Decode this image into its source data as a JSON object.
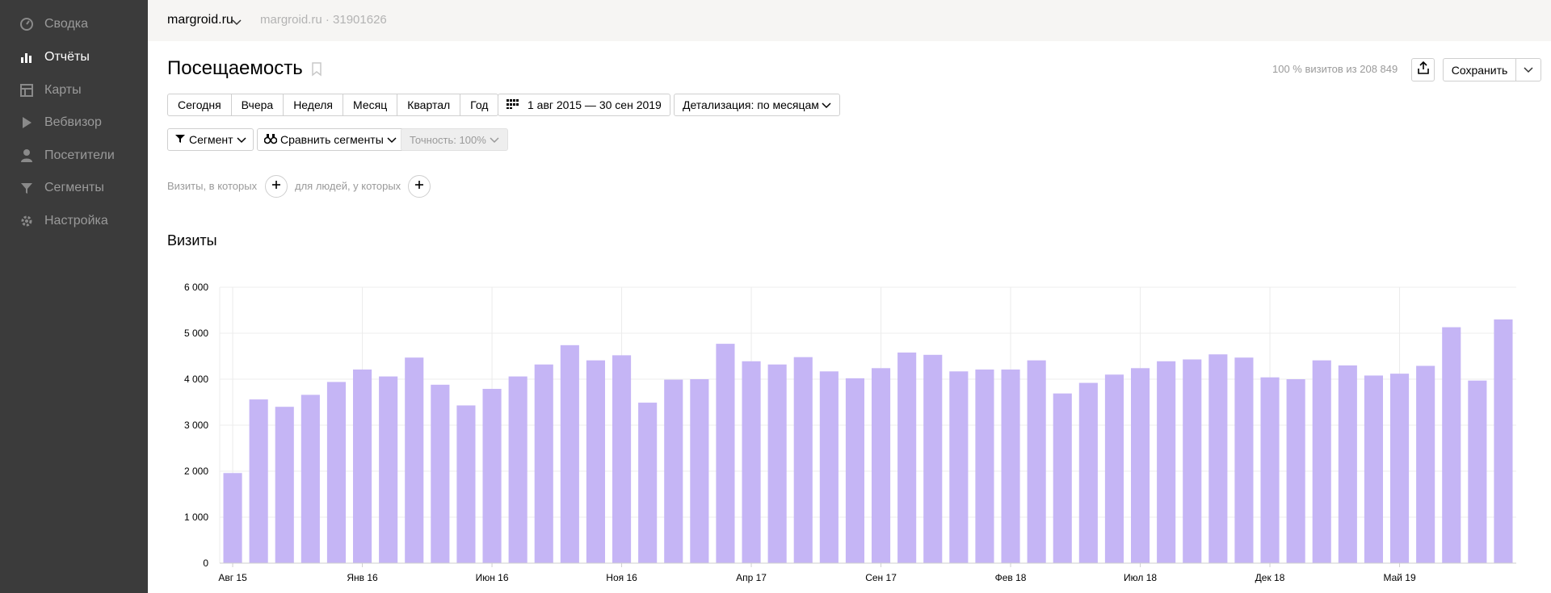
{
  "sidebar": {
    "items": [
      {
        "label": "Сводка",
        "icon": "dashboard-icon",
        "active": false
      },
      {
        "label": "Отчёты",
        "icon": "bar-chart-icon",
        "active": true
      },
      {
        "label": "Карты",
        "icon": "map-icon",
        "active": false
      },
      {
        "label": "Вебвизор",
        "icon": "play-icon",
        "active": false
      },
      {
        "label": "Посетители",
        "icon": "person-icon",
        "active": false
      },
      {
        "label": "Сегменты",
        "icon": "filter-icon",
        "active": false
      },
      {
        "label": "Настройка",
        "icon": "gear-icon",
        "active": false
      }
    ]
  },
  "topbar": {
    "site_name": "margroid.ru",
    "site_meta": "margroid.ru · 31901626"
  },
  "header": {
    "title": "Посещаемость",
    "visits_share": "100 % визитов из 208 849",
    "save_label": "Сохранить"
  },
  "periods": [
    "Сегодня",
    "Вчера",
    "Неделя",
    "Месяц",
    "Квартал",
    "Год"
  ],
  "date_range": "1 авг 2015 — 30 сен 2019",
  "detail": "Детализация: по месяцам",
  "segment_label": "Сегмент",
  "compare_label": "Сравнить сегменты",
  "accuracy_label": "Точность: 100%",
  "filters": {
    "visits_text": "Визиты, в которых",
    "people_text": "для людей, у которых"
  },
  "colors": {
    "sidebar_bg": "#3b3b3b",
    "topbar_bg": "#f6f5f3",
    "bar": "#c5b5f5",
    "grid": "#ececec"
  },
  "chart_data": {
    "type": "bar",
    "title": "Визиты",
    "ylim": [
      0,
      6000
    ],
    "y_ticks": [
      "0",
      "1 000",
      "2 000",
      "3 000",
      "4 000",
      "5 000",
      "6 000"
    ],
    "x_tick_labels": [
      {
        "label": "Авг 15",
        "index": 0
      },
      {
        "label": "Янв 16",
        "index": 5
      },
      {
        "label": "Июн 16",
        "index": 10
      },
      {
        "label": "Ноя 16",
        "index": 15
      },
      {
        "label": "Апр 17",
        "index": 20
      },
      {
        "label": "Сен 17",
        "index": 25
      },
      {
        "label": "Фев 18",
        "index": 30
      },
      {
        "label": "Июл 18",
        "index": 35
      },
      {
        "label": "Дек 18",
        "index": 40
      },
      {
        "label": "Май 19",
        "index": 45
      }
    ],
    "values": [
      1960,
      3560,
      3400,
      3660,
      3940,
      4210,
      4060,
      4470,
      3880,
      3430,
      3790,
      4060,
      4320,
      4740,
      4410,
      4520,
      3490,
      3990,
      4000,
      4770,
      4390,
      4320,
      4480,
      4170,
      4020,
      4240,
      4580,
      4530,
      4170,
      4210,
      4210,
      4410,
      3690,
      3920,
      4100,
      4240,
      4390,
      4430,
      4540,
      4470,
      4040,
      4000,
      4410,
      4300,
      4080,
      4120,
      4290,
      5130,
      3970,
      5300
    ]
  }
}
